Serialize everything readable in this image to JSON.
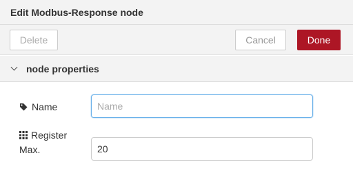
{
  "dialog": {
    "title": "Edit Modbus-Response node"
  },
  "toolbar": {
    "delete_label": "Delete",
    "cancel_label": "Cancel",
    "done_label": "Done"
  },
  "section": {
    "label": "node properties"
  },
  "fields": {
    "name": {
      "label": "Name",
      "value": "",
      "placeholder": "Name",
      "icon": "tag-icon"
    },
    "register": {
      "label": "Register Max.",
      "value": "20",
      "icon": "grid-icon"
    }
  },
  "colors": {
    "done_button": "#ad1625",
    "focus_border": "#66afe9",
    "panel_bg": "#f3f3f3"
  }
}
